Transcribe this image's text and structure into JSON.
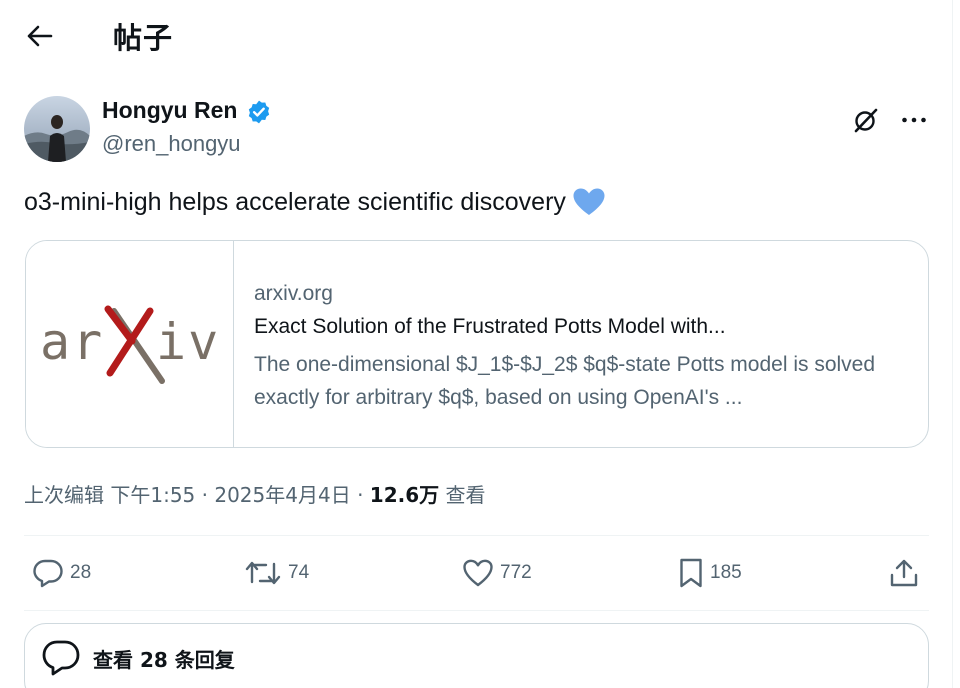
{
  "header": {
    "title": "帖子",
    "back_icon": "arrow-left-icon"
  },
  "post": {
    "author_name": "Hongyu Ren",
    "handle": "@ren_hongyu",
    "verified": true,
    "text": "o3-mini-high helps accelerate scientific discovery",
    "emoji": "blue-heart-icon",
    "link_card": {
      "domain": "arxiv.org",
      "title": "Exact Solution of the Frustrated Potts Model with...",
      "description": "The one-dimensional $J_1$-$J_2$ $q$-state Potts model is solved exactly for arbitrary $q$, based on using OpenAI's ...",
      "thumbnail_logo": "arXiv"
    },
    "meta": {
      "edited_label": "上次编辑",
      "time": "下午1:55",
      "separator": "·",
      "date": "2025年4月4日",
      "views_count": "12.6万",
      "views_label": "查看"
    },
    "actions": {
      "replies": "28",
      "reposts": "74",
      "likes": "772",
      "bookmarks": "185"
    },
    "show_replies_label": "查看 28 条回复"
  },
  "colors": {
    "text_primary": "#0f1419",
    "text_secondary": "#536471",
    "border": "#cfd9de",
    "verified_blue": "#1d9bf0",
    "heart_blue": "#6ea8ee",
    "arxiv_red": "#b31b1b",
    "arxiv_gray": "#7a7066"
  }
}
